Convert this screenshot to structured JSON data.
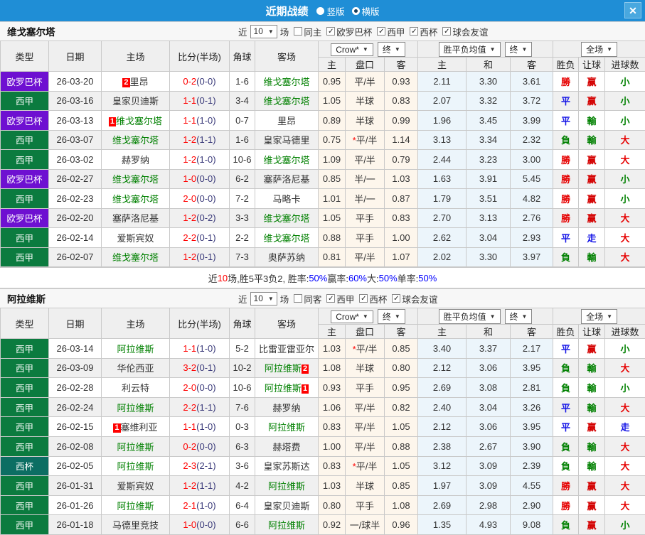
{
  "titlebar": {
    "title": "近期战绩",
    "layout_options": [
      {
        "label": "竖版",
        "selected": false
      },
      {
        "label": "横版",
        "selected": true
      }
    ],
    "close": "✕"
  },
  "table": {
    "left_headers": [
      "类型",
      "日期",
      "主场",
      "比分(半场)",
      "角球",
      "客场"
    ],
    "group_dropdowns": {
      "odds_source": "Crow*",
      "odds_final": "终",
      "avg_label": "胜平负均值",
      "avg_final": "终",
      "scope": "全场"
    },
    "sub_headers": [
      "主",
      "盘口",
      "客",
      "主",
      "和",
      "客",
      "胜负",
      "让球",
      "进球数"
    ]
  },
  "colors": {
    "type": {
      "欧罗巴杯": "#6e10d1",
      "西甲": "#0b7b3f",
      "西杯": "#0c6e63"
    },
    "result": {
      "勝": "#e60000",
      "平": "#1414e6",
      "負": "#008000",
      "赢": "#d40000",
      "輸": "#008000",
      "走": "#1414e6",
      "大": "#e60000",
      "小": "#008000"
    },
    "focal_team": "#008000",
    "score": "#ff0000",
    "half_time": "#3a3a7a"
  },
  "sections": [
    {
      "team": "维戈塞尔塔",
      "filter": {
        "prefix": "近",
        "count": "10",
        "suffix": "场",
        "same": {
          "label": "同主",
          "checked": false
        },
        "leagues": [
          {
            "label": "欧罗巴杯",
            "checked": true
          },
          {
            "label": "西甲",
            "checked": true
          },
          {
            "label": "西杯",
            "checked": true
          },
          {
            "label": "球会友谊",
            "checked": true
          }
        ]
      },
      "rows": [
        {
          "type": "欧罗巴杯",
          "date": "26-03-20",
          "home": {
            "name": "里昂",
            "focal": false,
            "card": "2",
            "card_pos": "before"
          },
          "score": "0-2",
          "half": "(0-0)",
          "corners": "1-6",
          "away": {
            "name": "维戈塞尔塔",
            "focal": true
          },
          "odds": {
            "h": "0.95",
            "hcp": "平/半",
            "star": false,
            "a": "0.93"
          },
          "avg": [
            "2.11",
            "3.30",
            "3.61"
          ],
          "outcome": [
            "勝",
            "赢",
            "小"
          ]
        },
        {
          "type": "西甲",
          "date": "26-03-16",
          "home": {
            "name": "皇家贝迪斯",
            "focal": false
          },
          "score": "1-1",
          "half": "(0-1)",
          "corners": "3-4",
          "away": {
            "name": "维戈塞尔塔",
            "focal": true
          },
          "odds": {
            "h": "1.05",
            "hcp": "半球",
            "star": false,
            "a": "0.83"
          },
          "avg": [
            "2.07",
            "3.32",
            "3.72"
          ],
          "outcome": [
            "平",
            "赢",
            "小"
          ]
        },
        {
          "type": "欧罗巴杯",
          "date": "26-03-13",
          "home": {
            "name": "维戈塞尔塔",
            "focal": true,
            "card": "1",
            "card_pos": "before"
          },
          "score": "1-1",
          "half": "(1-0)",
          "corners": "0-7",
          "away": {
            "name": "里昂",
            "focal": false
          },
          "odds": {
            "h": "0.89",
            "hcp": "半球",
            "star": false,
            "a": "0.99"
          },
          "avg": [
            "1.96",
            "3.45",
            "3.99"
          ],
          "outcome": [
            "平",
            "輸",
            "小"
          ]
        },
        {
          "type": "西甲",
          "date": "26-03-07",
          "home": {
            "name": "维戈塞尔塔",
            "focal": true
          },
          "score": "1-2",
          "half": "(1-1)",
          "corners": "1-6",
          "away": {
            "name": "皇家马德里",
            "focal": false
          },
          "odds": {
            "h": "0.75",
            "hcp": "平/半",
            "star": true,
            "a": "1.14"
          },
          "avg": [
            "3.13",
            "3.34",
            "2.32"
          ],
          "outcome": [
            "負",
            "輸",
            "大"
          ]
        },
        {
          "type": "西甲",
          "date": "26-03-02",
          "home": {
            "name": "赫罗纳",
            "focal": false
          },
          "score": "1-2",
          "half": "(1-0)",
          "corners": "10-6",
          "away": {
            "name": "维戈塞尔塔",
            "focal": true
          },
          "odds": {
            "h": "1.09",
            "hcp": "平/半",
            "star": false,
            "a": "0.79"
          },
          "avg": [
            "2.44",
            "3.23",
            "3.00"
          ],
          "outcome": [
            "勝",
            "赢",
            "大"
          ]
        },
        {
          "type": "欧罗巴杯",
          "date": "26-02-27",
          "home": {
            "name": "维戈塞尔塔",
            "focal": true
          },
          "score": "1-0",
          "half": "(0-0)",
          "corners": "6-2",
          "away": {
            "name": "塞萨洛尼基",
            "focal": false
          },
          "odds": {
            "h": "0.85",
            "hcp": "半/一",
            "star": false,
            "a": "1.03"
          },
          "avg": [
            "1.63",
            "3.91",
            "5.45"
          ],
          "outcome": [
            "勝",
            "赢",
            "小"
          ]
        },
        {
          "type": "西甲",
          "date": "26-02-23",
          "home": {
            "name": "维戈塞尔塔",
            "focal": true
          },
          "score": "2-0",
          "half": "(0-0)",
          "corners": "7-2",
          "away": {
            "name": "马略卡",
            "focal": false
          },
          "odds": {
            "h": "1.01",
            "hcp": "半/一",
            "star": false,
            "a": "0.87"
          },
          "avg": [
            "1.79",
            "3.51",
            "4.82"
          ],
          "outcome": [
            "勝",
            "赢",
            "小"
          ]
        },
        {
          "type": "欧罗巴杯",
          "date": "26-02-20",
          "home": {
            "name": "塞萨洛尼基",
            "focal": false
          },
          "score": "1-2",
          "half": "(0-2)",
          "corners": "3-3",
          "away": {
            "name": "维戈塞尔塔",
            "focal": true
          },
          "odds": {
            "h": "1.05",
            "hcp": "平手",
            "star": false,
            "a": "0.83"
          },
          "avg": [
            "2.70",
            "3.13",
            "2.76"
          ],
          "outcome": [
            "勝",
            "赢",
            "大"
          ]
        },
        {
          "type": "西甲",
          "date": "26-02-14",
          "home": {
            "name": "爱斯宾奴",
            "focal": false
          },
          "score": "2-2",
          "half": "(0-1)",
          "corners": "2-2",
          "away": {
            "name": "维戈塞尔塔",
            "focal": true
          },
          "odds": {
            "h": "0.88",
            "hcp": "平手",
            "star": false,
            "a": "1.00"
          },
          "avg": [
            "2.62",
            "3.04",
            "2.93"
          ],
          "outcome": [
            "平",
            "走",
            "大"
          ]
        },
        {
          "type": "西甲",
          "date": "26-02-07",
          "home": {
            "name": "维戈塞尔塔",
            "focal": true
          },
          "score": "1-2",
          "half": "(0-1)",
          "corners": "7-3",
          "away": {
            "name": "奥萨苏纳",
            "focal": false
          },
          "odds": {
            "h": "0.81",
            "hcp": "平/半",
            "star": false,
            "a": "1.07"
          },
          "avg": [
            "2.02",
            "3.30",
            "3.97"
          ],
          "outcome": [
            "負",
            "輸",
            "大"
          ]
        }
      ],
      "summary": [
        {
          "t": "近",
          "c": "text"
        },
        {
          "t": "10",
          "c": "red"
        },
        {
          "t": "场,胜5平3负2, 胜率:",
          "c": "text"
        },
        {
          "t": "50%",
          "c": "blue"
        },
        {
          "t": " 赢率:",
          "c": "text"
        },
        {
          "t": "60%",
          "c": "blue"
        },
        {
          "t": " 大:",
          "c": "text"
        },
        {
          "t": "50%",
          "c": "blue"
        },
        {
          "t": " 单率:",
          "c": "text"
        },
        {
          "t": "50%",
          "c": "blue"
        }
      ]
    },
    {
      "team": "阿拉维斯",
      "filter": {
        "prefix": "近",
        "count": "10",
        "suffix": "场",
        "same": {
          "label": "同客",
          "checked": false
        },
        "leagues": [
          {
            "label": "西甲",
            "checked": true
          },
          {
            "label": "西杯",
            "checked": true
          },
          {
            "label": "球会友谊",
            "checked": true
          }
        ]
      },
      "rows": [
        {
          "type": "西甲",
          "date": "26-03-14",
          "home": {
            "name": "阿拉维斯",
            "focal": true
          },
          "score": "1-1",
          "half": "(1-0)",
          "corners": "5-2",
          "away": {
            "name": "比雷亚雷亚尔",
            "focal": false
          },
          "odds": {
            "h": "1.03",
            "hcp": "平/半",
            "star": true,
            "a": "0.85"
          },
          "avg": [
            "3.40",
            "3.37",
            "2.17"
          ],
          "outcome": [
            "平",
            "赢",
            "小"
          ]
        },
        {
          "type": "西甲",
          "date": "26-03-09",
          "home": {
            "name": "华伦西亚",
            "focal": false
          },
          "score": "3-2",
          "half": "(0-1)",
          "corners": "10-2",
          "away": {
            "name": "阿拉维斯",
            "focal": true,
            "card": "2",
            "card_pos": "after"
          },
          "odds": {
            "h": "1.08",
            "hcp": "半球",
            "star": false,
            "a": "0.80"
          },
          "avg": [
            "2.12",
            "3.06",
            "3.95"
          ],
          "outcome": [
            "負",
            "輸",
            "大"
          ]
        },
        {
          "type": "西甲",
          "date": "26-02-28",
          "home": {
            "name": "利云特",
            "focal": false
          },
          "score": "2-0",
          "half": "(0-0)",
          "corners": "10-6",
          "away": {
            "name": "阿拉维斯",
            "focal": true,
            "card": "1",
            "card_pos": "after"
          },
          "odds": {
            "h": "0.93",
            "hcp": "平手",
            "star": false,
            "a": "0.95"
          },
          "avg": [
            "2.69",
            "3.08",
            "2.81"
          ],
          "outcome": [
            "負",
            "輸",
            "小"
          ]
        },
        {
          "type": "西甲",
          "date": "26-02-24",
          "home": {
            "name": "阿拉维斯",
            "focal": true
          },
          "score": "2-2",
          "half": "(1-1)",
          "corners": "7-6",
          "away": {
            "name": "赫罗纳",
            "focal": false
          },
          "odds": {
            "h": "1.06",
            "hcp": "平/半",
            "star": false,
            "a": "0.82"
          },
          "avg": [
            "2.40",
            "3.04",
            "3.26"
          ],
          "outcome": [
            "平",
            "輸",
            "大"
          ]
        },
        {
          "type": "西甲",
          "date": "26-02-15",
          "home": {
            "name": "塞维利亚",
            "focal": false,
            "card": "1",
            "card_pos": "before"
          },
          "score": "1-1",
          "half": "(1-0)",
          "corners": "0-3",
          "away": {
            "name": "阿拉维斯",
            "focal": true
          },
          "odds": {
            "h": "0.83",
            "hcp": "平/半",
            "star": false,
            "a": "1.05"
          },
          "avg": [
            "2.12",
            "3.06",
            "3.95"
          ],
          "outcome": [
            "平",
            "赢",
            "走"
          ]
        },
        {
          "type": "西甲",
          "date": "26-02-08",
          "home": {
            "name": "阿拉维斯",
            "focal": true
          },
          "score": "0-2",
          "half": "(0-0)",
          "corners": "6-3",
          "away": {
            "name": "赫塔费",
            "focal": false
          },
          "odds": {
            "h": "1.00",
            "hcp": "平/半",
            "star": false,
            "a": "0.88"
          },
          "avg": [
            "2.38",
            "2.67",
            "3.90"
          ],
          "outcome": [
            "負",
            "輸",
            "大"
          ]
        },
        {
          "type": "西杯",
          "date": "26-02-05",
          "home": {
            "name": "阿拉维斯",
            "focal": true
          },
          "score": "2-3",
          "half": "(2-1)",
          "corners": "3-6",
          "away": {
            "name": "皇家苏斯达",
            "focal": false
          },
          "odds": {
            "h": "0.83",
            "hcp": "平/半",
            "star": true,
            "a": "1.05"
          },
          "avg": [
            "3.12",
            "3.09",
            "2.39"
          ],
          "outcome": [
            "負",
            "輸",
            "大"
          ]
        },
        {
          "type": "西甲",
          "date": "26-01-31",
          "home": {
            "name": "爱斯宾奴",
            "focal": false
          },
          "score": "1-2",
          "half": "(1-1)",
          "corners": "4-2",
          "away": {
            "name": "阿拉维斯",
            "focal": true
          },
          "odds": {
            "h": "1.03",
            "hcp": "半球",
            "star": false,
            "a": "0.85"
          },
          "avg": [
            "1.97",
            "3.09",
            "4.55"
          ],
          "outcome": [
            "勝",
            "赢",
            "大"
          ]
        },
        {
          "type": "西甲",
          "date": "26-01-26",
          "home": {
            "name": "阿拉维斯",
            "focal": true
          },
          "score": "2-1",
          "half": "(1-0)",
          "corners": "6-4",
          "away": {
            "name": "皇家贝迪斯",
            "focal": false
          },
          "odds": {
            "h": "0.80",
            "hcp": "平手",
            "star": false,
            "a": "1.08"
          },
          "avg": [
            "2.69",
            "2.98",
            "2.90"
          ],
          "outcome": [
            "勝",
            "赢",
            "大"
          ]
        },
        {
          "type": "西甲",
          "date": "26-01-18",
          "home": {
            "name": "马德里竞技",
            "focal": false
          },
          "score": "1-0",
          "half": "(0-0)",
          "corners": "6-6",
          "away": {
            "name": "阿拉维斯",
            "focal": true
          },
          "odds": {
            "h": "0.92",
            "hcp": "一/球半",
            "star": false,
            "a": "0.96"
          },
          "avg": [
            "1.35",
            "4.93",
            "9.08"
          ],
          "outcome": [
            "負",
            "赢",
            "小"
          ]
        }
      ],
      "summary": null
    }
  ]
}
